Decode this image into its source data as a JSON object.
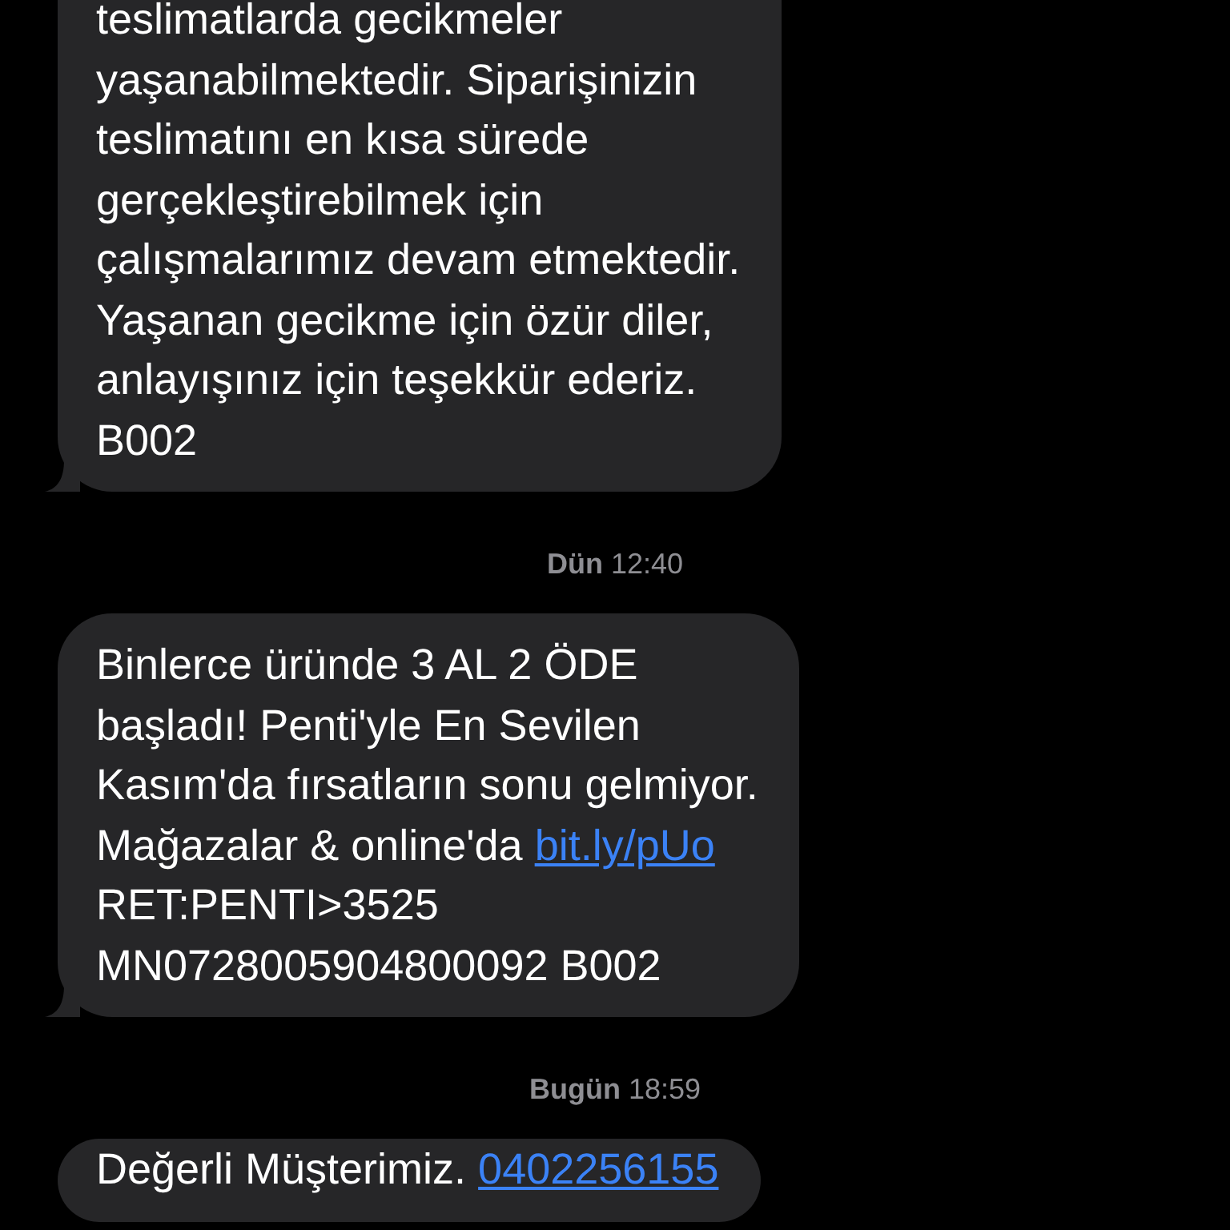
{
  "messages": [
    {
      "lines": [
        [
          {
            "text": "teslimatlarda gecikmeler"
          }
        ],
        [
          {
            "text": "yaşanabilmektedir. Siparişinizin"
          }
        ],
        [
          {
            "text": "teslimatını en kısa sürede"
          }
        ],
        [
          {
            "text": "gerçekleştirebilmek için"
          }
        ],
        [
          {
            "text": "çalışmalarımız devam etmektedir."
          }
        ],
        [
          {
            "text": "Yaşanan gecikme için özür diler,"
          }
        ],
        [
          {
            "text": "anlayışınız için teşekkür ederiz."
          }
        ],
        [
          {
            "text": "B002"
          }
        ]
      ]
    },
    {
      "timestamp": "**Dün** 12:40",
      "lines": [
        [
          {
            "text": "Binlerce üründe 3 AL 2 ÖDE"
          }
        ],
        [
          {
            "text": "başladı! Penti'yle En Sevilen"
          }
        ],
        [
          {
            "text": "Kasım'da fırsatların sonu gelmiyor."
          }
        ],
        [
          {
            "text": "Mağazalar & online'da "
          },
          {
            "text": "bit.ly/pUo",
            "kind": "link"
          }
        ],
        [
          {
            "text": "RET:PENTI>3525"
          }
        ],
        [
          {
            "text": "MN0728005904800092 B002"
          }
        ]
      ]
    },
    {
      "timestamp": "**Bugün** 18:59",
      "lines": [
        [
          {
            "text": "Değerli Müşterimiz. "
          },
          {
            "text": "0402256155",
            "kind": "link"
          }
        ]
      ]
    }
  ]
}
